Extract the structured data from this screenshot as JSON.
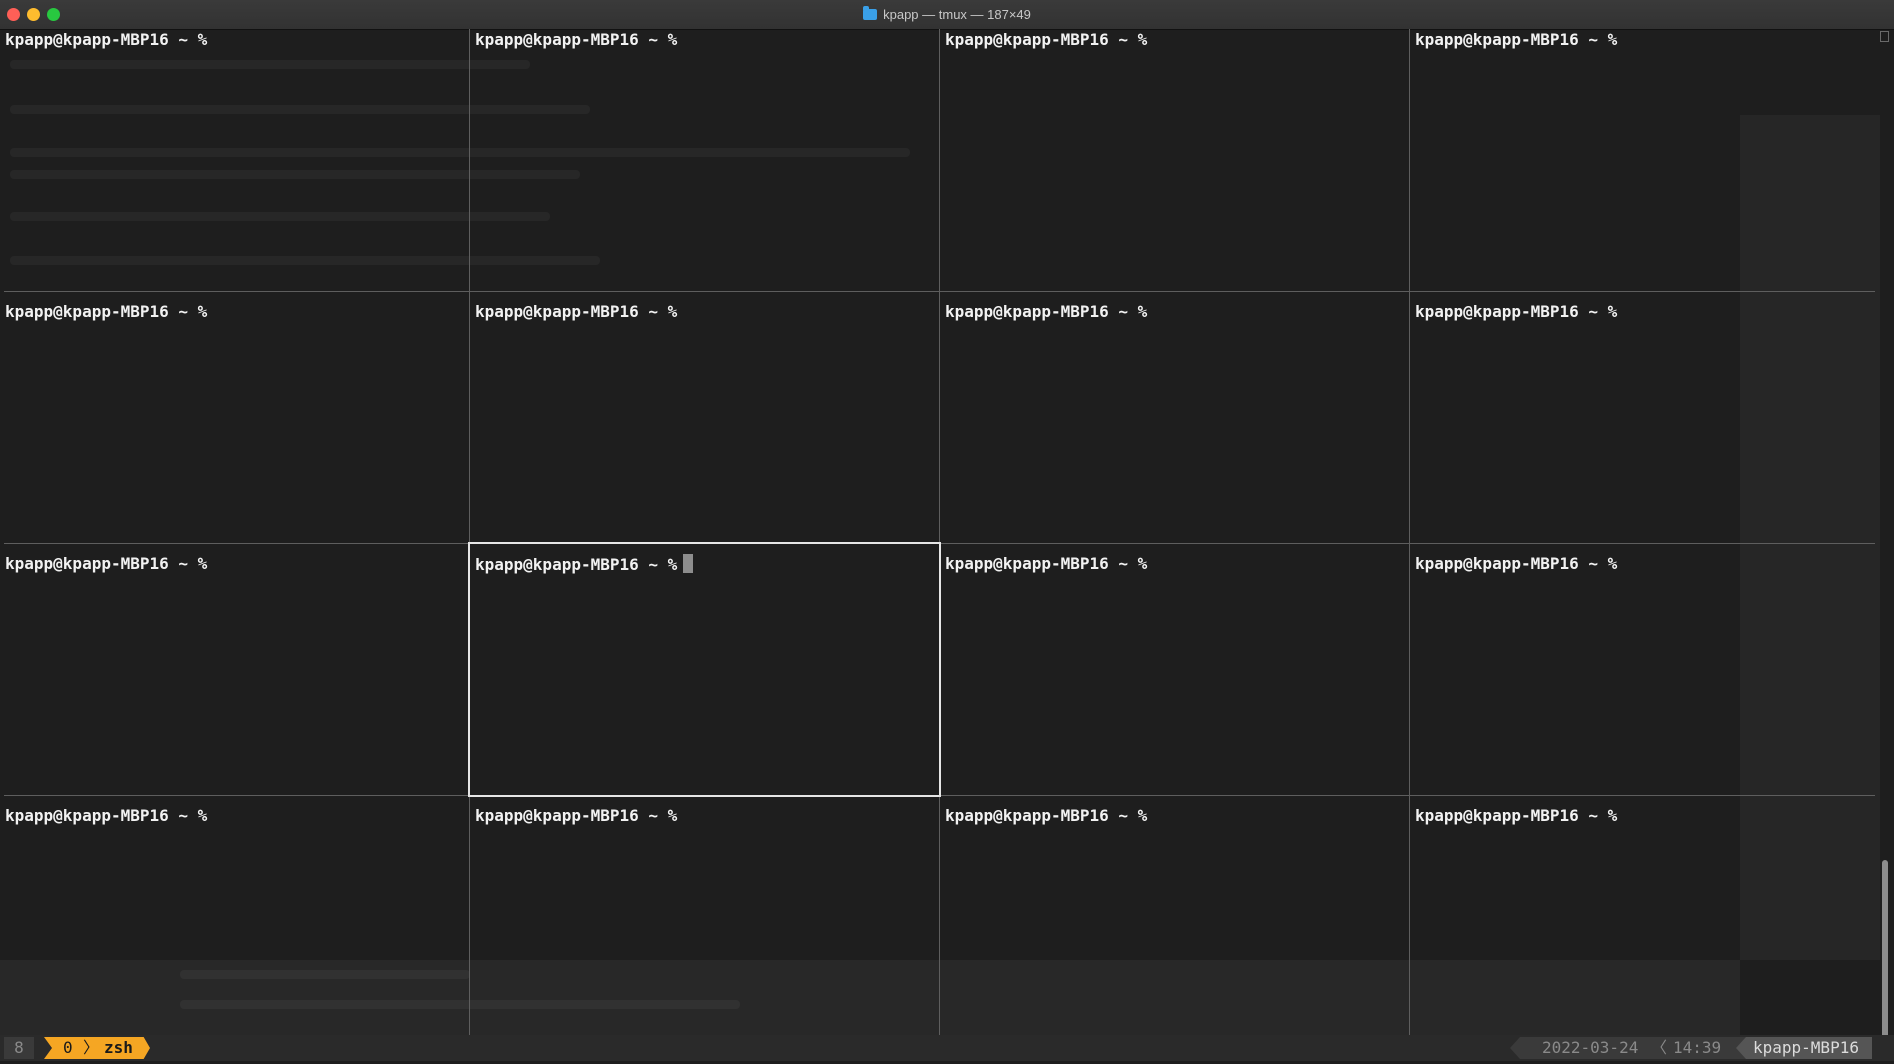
{
  "window": {
    "title": "kpapp — tmux — 187×49"
  },
  "panes": {
    "prompt": "kpapp@kpapp-MBP16 ~ %",
    "active_index": 9,
    "count": 16
  },
  "statusbar": {
    "session": "8",
    "window_index": "0",
    "window_sep": "〉",
    "window_name": "zsh",
    "date": "2022-03-24",
    "time_sep": "〈",
    "time": "14:39",
    "hostname": "kpapp-MBP16"
  },
  "colors": {
    "accent": "#f5a623",
    "background": "#1e1e1e",
    "pane_border": "#5e5e5e",
    "active_border": "#e6e6e6"
  },
  "icons": [
    "folder-icon",
    "cursor-block"
  ]
}
